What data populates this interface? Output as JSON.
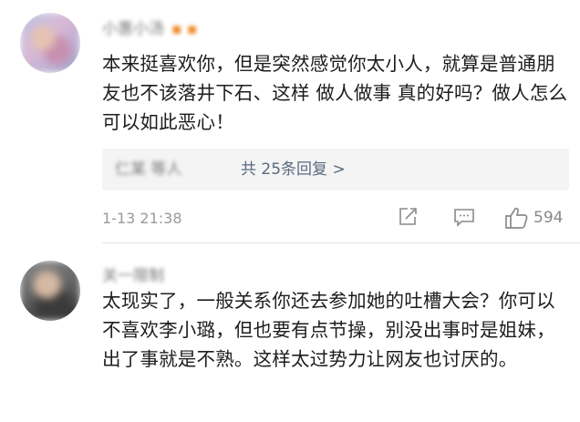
{
  "comments": [
    {
      "user": "小惠小汤",
      "badge": "▪ ▪",
      "text": "本来挺喜欢你，但是突然感觉你太小人，就算是普通朋友也不该落井下石、这样 做人做事 真的好吗？做人怎么可以如此恶心！",
      "replies_who": "仁某 等人",
      "replies_count": "共 25条回复 >",
      "time": "1-13 21:38",
      "likes": "594",
      "icons": [
        "share-icon",
        "comment-icon",
        "like-icon"
      ]
    },
    {
      "user": "关一限制",
      "text": "太现实了，一般关系你还去参加她的吐槽大会？你可以不喜欢李小璐，但也要有点节操，别没出事时是姐妹，出了事就是不熟。这样太过势力让网友也讨厌的。"
    }
  ]
}
